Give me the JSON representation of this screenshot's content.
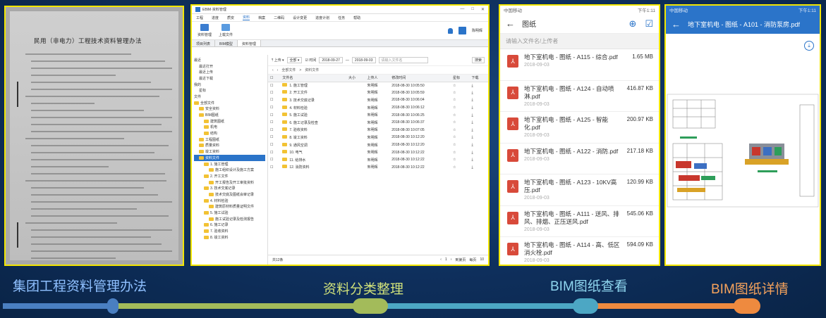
{
  "panel_doc": {
    "title": "民用（非电力）工程技术资料管理办法"
  },
  "desktop": {
    "app_title": "EBIM·资料管理",
    "window_controls": [
      "—",
      "□",
      "✕"
    ],
    "menu": [
      "工程",
      "进度",
      "质安",
      "资料",
      "档案",
      "二维码",
      "设计变更",
      "进度计划",
      "任务",
      "帮助"
    ],
    "menu_active_index": 3,
    "ribbon": [
      {
        "label": "资料管理",
        "icon": "folder-manage-icon"
      },
      {
        "label": "上载文件",
        "icon": "image-upload-icon"
      }
    ],
    "user_name": "陈明辉",
    "tabs": [
      "项目列表",
      "BIM模型",
      "资料管理"
    ],
    "tab_active_index": 2,
    "tree": [
      {
        "label": "最近",
        "indent": 0,
        "folder": false
      },
      {
        "label": "最近打开",
        "indent": 1,
        "folder": false
      },
      {
        "label": "最近上传",
        "indent": 1,
        "folder": false
      },
      {
        "label": "最近下载",
        "indent": 1,
        "folder": false
      },
      {
        "label": "我的",
        "indent": 0,
        "folder": false
      },
      {
        "label": "星标",
        "indent": 1,
        "folder": false
      },
      {
        "label": "文件",
        "indent": 0,
        "folder": false
      },
      {
        "label": "全部文件",
        "indent": 0,
        "folder": true
      },
      {
        "label": "安全资料",
        "indent": 1,
        "folder": true
      },
      {
        "label": "BIM图纸",
        "indent": 1,
        "folder": true
      },
      {
        "label": "建筑图纸",
        "indent": 2,
        "folder": true
      },
      {
        "label": "机电",
        "indent": 2,
        "folder": true
      },
      {
        "label": "结构",
        "indent": 2,
        "folder": true
      },
      {
        "label": "工程图纸",
        "indent": 1,
        "folder": true
      },
      {
        "label": "质量资料",
        "indent": 1,
        "folder": true
      },
      {
        "label": "竣工资料",
        "indent": 1,
        "folder": true
      },
      {
        "label": "资料文件",
        "indent": 1,
        "folder": true,
        "selected": true
      },
      {
        "label": "1. 施工管理",
        "indent": 2,
        "folder": true
      },
      {
        "label": "施工组织设计及施工方案",
        "indent": 3,
        "folder": true
      },
      {
        "label": "2. 开工文件",
        "indent": 2,
        "folder": true
      },
      {
        "label": "开工报告及开工审批资料",
        "indent": 3,
        "folder": true
      },
      {
        "label": "3. 技术交底记录",
        "indent": 2,
        "folder": true
      },
      {
        "label": "技术交底及图纸会审记录",
        "indent": 3,
        "folder": true
      },
      {
        "label": "4. 材料检验",
        "indent": 2,
        "folder": true
      },
      {
        "label": "建筑原材料质量证明文件",
        "indent": 3,
        "folder": true
      },
      {
        "label": "5. 施工试验",
        "indent": 2,
        "folder": true
      },
      {
        "label": "施工试验记录及检测报告",
        "indent": 3,
        "folder": true
      },
      {
        "label": "6. 施工记录",
        "indent": 2,
        "folder": true
      },
      {
        "label": "7. 验收资料",
        "indent": 2,
        "folder": true
      },
      {
        "label": "8. 竣工资料",
        "indent": 2,
        "folder": true
      }
    ],
    "filter": {
      "upload_label": "上传",
      "type_value": "全部",
      "checkbox_label": "时间",
      "date_from": "2018-09-27",
      "date_sep": "—",
      "date_to": "2018-09-03",
      "search_placeholder": "请输入文件名",
      "search_button": "搜索"
    },
    "breadcrumb": [
      "全部文件",
      "资料文件"
    ],
    "columns": [
      "文件名",
      "大小",
      "上传人",
      "修改时间",
      "星标",
      "下载"
    ],
    "rows": [
      {
        "name": "1. 施工管理",
        "uploader": "朱明辉",
        "time": "2018-08-30 10:05:50"
      },
      {
        "name": "2. 开工文件",
        "uploader": "朱明辉",
        "time": "2018-08-30 10:05:59"
      },
      {
        "name": "3. 技术交底记录",
        "uploader": "朱明辉",
        "time": "2018-08-30 10:06:04"
      },
      {
        "name": "4. 材料检验",
        "uploader": "朱明辉",
        "time": "2018-08-30 10:06:12"
      },
      {
        "name": "5. 施工试验",
        "uploader": "朱明辉",
        "time": "2018-08-30 10:06:25"
      },
      {
        "name": "6. 施工记录及检查",
        "uploader": "朱明辉",
        "time": "2018-08-30 10:06:37"
      },
      {
        "name": "7. 验收资料",
        "uploader": "朱明辉",
        "time": "2018-08-30 10:07:05"
      },
      {
        "name": "8. 竣工资料",
        "uploader": "朱明辉",
        "time": "2018-08-30 10:12:20"
      },
      {
        "name": "9. 通风空调",
        "uploader": "朱明辉",
        "time": "2018-08-30 10:12:20"
      },
      {
        "name": "10. 电气",
        "uploader": "朱明辉",
        "time": "2018-08-30 10:12:22"
      },
      {
        "name": "11. 给排水",
        "uploader": "朱明辉",
        "time": "2018-08-30 10:12:22"
      },
      {
        "name": "12. 消防资料",
        "uploader": "朱明辉",
        "time": "2018-08-30 10:12:22"
      }
    ],
    "footer_count": "共12条",
    "pager": [
      "‹",
      "1",
      "›",
      "到第页",
      "每页",
      "10"
    ]
  },
  "mobile_list": {
    "status_left": "中国移动",
    "status_right": "下午1:11",
    "title": "图纸",
    "search_placeholder": "请输入文件名/上传者",
    "items": [
      {
        "name": "地下室机电 - 图纸 - A115 - 综合.pdf",
        "size": "1.65 MB",
        "date": "2018-09-03"
      },
      {
        "name": "地下室机电 - 图纸 - A124 - 自动喷淋.pdf",
        "size": "416.87 KB",
        "date": "2018-09-03"
      },
      {
        "name": "地下室机电 - 图纸 - A125 - 智能化.pdf",
        "size": "200.97 KB",
        "date": "2018-09-03"
      },
      {
        "name": "地下室机电 - 图纸 - A122 - 消防.pdf",
        "size": "217.18 KB",
        "date": "2018-09-03"
      },
      {
        "name": "地下室机电 - 图纸 - A123 - 10KV高压.pdf",
        "size": "120.99 KB",
        "date": "2018-09-03"
      },
      {
        "name": "地下室机电 - 图纸 - A111 - 送风、排风、排烟、正压送风.pdf",
        "size": "545.06 KB",
        "date": "2018-09-03"
      },
      {
        "name": "地下室机电 - 图纸 - A114 - 高、低区消火栓.pdf",
        "size": "594.09 KB",
        "date": "2018-09-03"
      }
    ]
  },
  "mobile_bim": {
    "status_left": "中国移动",
    "status_right": "下午1:11",
    "title": "地下室机电 - 图纸 - A101 - 消防泵房.pdf"
  },
  "timeline": {
    "labels": [
      "集团工程资料管理办法",
      "资料分类整理",
      "BIM图纸查看",
      "BIM图纸详情"
    ],
    "colors": {
      "blue": "#4a7fc1",
      "green": "#a3bb5a",
      "teal": "#4ca7c4",
      "orange": "#ee8a3f",
      "border": "#f2e600"
    }
  }
}
